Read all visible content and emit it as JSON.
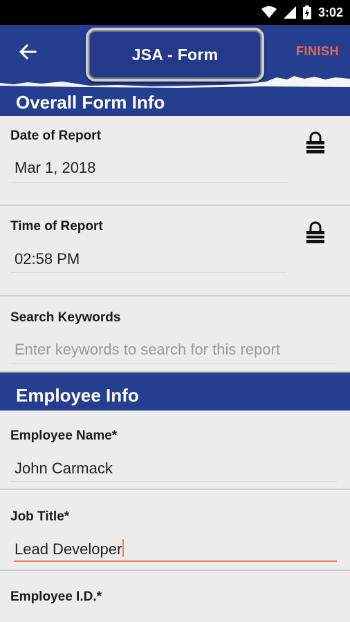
{
  "status_bar": {
    "time": "3:02",
    "icons": [
      "wifi-icon",
      "cell-signal-icon",
      "battery-charging-icon"
    ]
  },
  "app_bar": {
    "back_icon": "arrow-left-icon",
    "title": "JSA - Form",
    "finish_label": "FINISH"
  },
  "sections": {
    "overall": "Overall Form Info",
    "employee": "Employee Info"
  },
  "fields": {
    "date_of_report": {
      "label": "Date of Report",
      "value": "Mar 1, 2018",
      "icon": "lock-icon"
    },
    "time_of_report": {
      "label": "Time of Report",
      "value": "02:58 PM",
      "icon": "lock-icon"
    },
    "search_keywords": {
      "label": "Search Keywords",
      "placeholder": "Enter keywords to search for this report"
    },
    "employee_name": {
      "label": "Employee Name*",
      "value": "John Carmack"
    },
    "job_title": {
      "label": "Job Title*",
      "value": "Lead Developer"
    },
    "employee_id": {
      "label": "Employee I.D.*"
    }
  },
  "colors": {
    "primary": "#263e8f",
    "accent": "#f07d4a",
    "finish": "#e9684f"
  }
}
